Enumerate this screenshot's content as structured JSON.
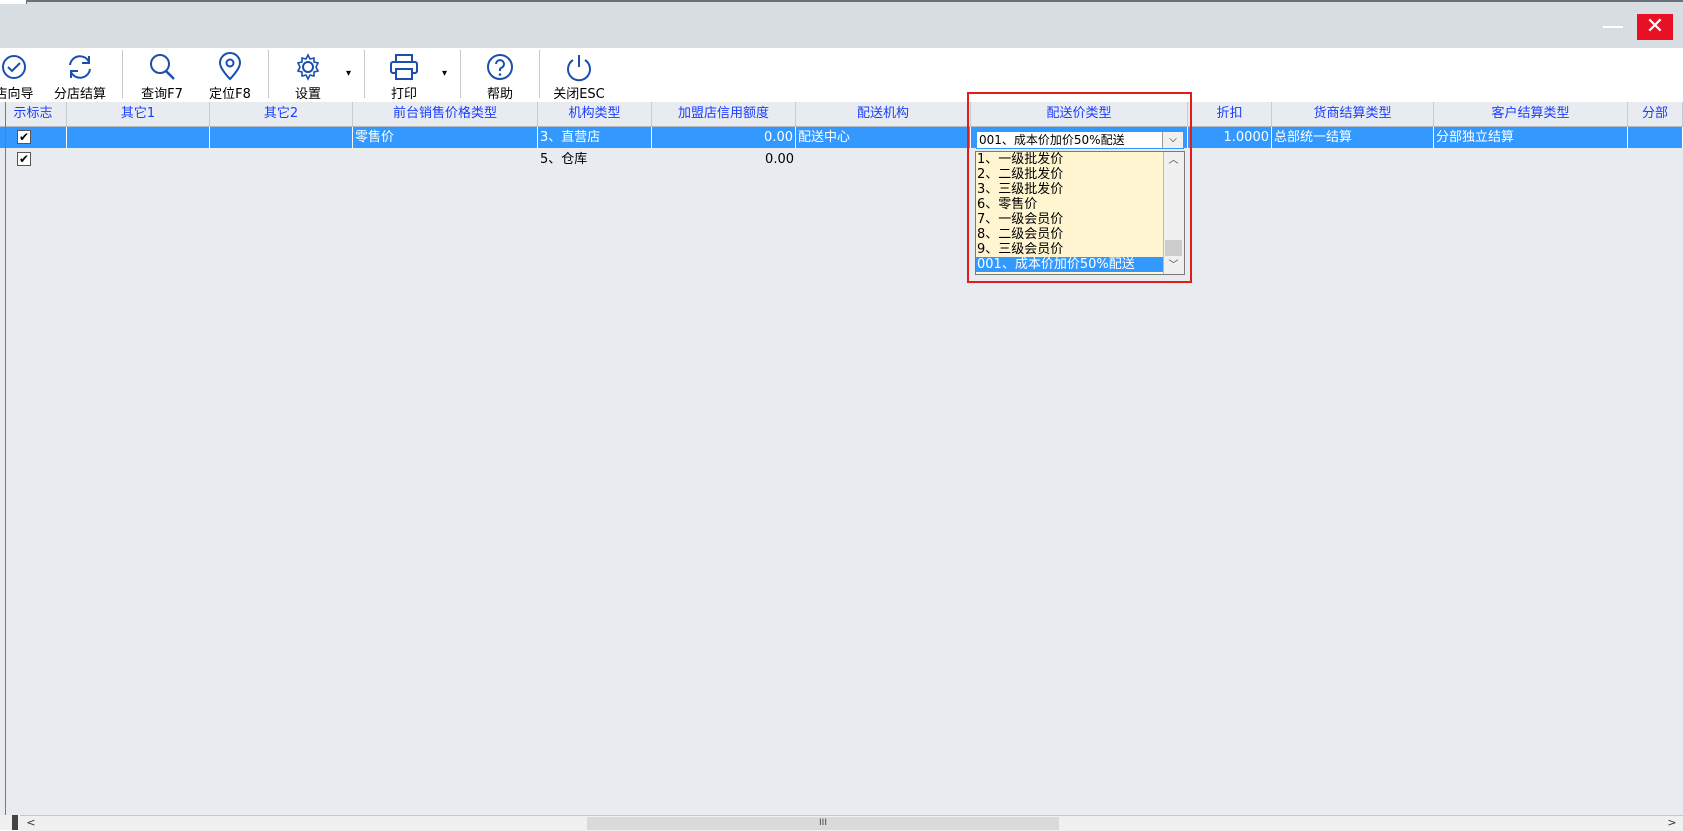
{
  "window": {
    "close_glyph": "✕",
    "minimize_glyph": "—"
  },
  "toolbar": {
    "buttons": [
      {
        "label": "店向导",
        "icon": "check-circle-icon"
      },
      {
        "label": "分店结算",
        "icon": "refresh-icon"
      },
      {
        "label": "查询F7",
        "icon": "search-icon"
      },
      {
        "label": "定位F8",
        "icon": "location-pin-icon"
      },
      {
        "label": "设置",
        "icon": "gear-icon"
      },
      {
        "label": "打印",
        "icon": "printer-icon"
      },
      {
        "label": "帮助",
        "icon": "help-icon"
      },
      {
        "label": "关闭ESC",
        "icon": "power-icon"
      }
    ],
    "caret": "▾"
  },
  "grid": {
    "columns": [
      "示标志",
      "其它1",
      "其它2",
      "前台销售价格类型",
      "机构类型",
      "加盟店信用额度",
      "配送机构",
      "配送价类型",
      "折扣",
      "货商结算类型",
      "客户结算类型",
      "分部"
    ],
    "rows": [
      {
        "checked": true,
        "other1": "",
        "other2": "",
        "front_price_type": "零售价",
        "org_type": "3、直营店",
        "credit": "0.00",
        "dist_org": "配送中心",
        "dist_price_type": "001、成本价加价50%配送",
        "discount": "1.0000",
        "supplier_settle": "总部统一结算",
        "customer_settle": "分部独立结算",
        "branch": ""
      },
      {
        "checked": true,
        "other1": "",
        "other2": "",
        "front_price_type": "",
        "org_type": "5、仓库",
        "credit": "0.00",
        "dist_org": "",
        "dist_price_type": "",
        "discount": "",
        "supplier_settle": "",
        "customer_settle": "",
        "branch": ""
      }
    ]
  },
  "combo": {
    "value": "001、成本价加价50%配送",
    "arrow": "⌵",
    "options": [
      "1、一级批发价",
      "2、二级批发价",
      "3、三级批发价",
      "6、零售价",
      "7、一级会员价",
      "8、二级会员价",
      "9、三级会员价",
      "001、成本价加价50%配送"
    ],
    "selected_index": 7
  },
  "scroll": {
    "left": "<",
    "right": ">",
    "grip": "III",
    "up": "︿",
    "down": "﹀"
  },
  "check_glyph": "✔"
}
